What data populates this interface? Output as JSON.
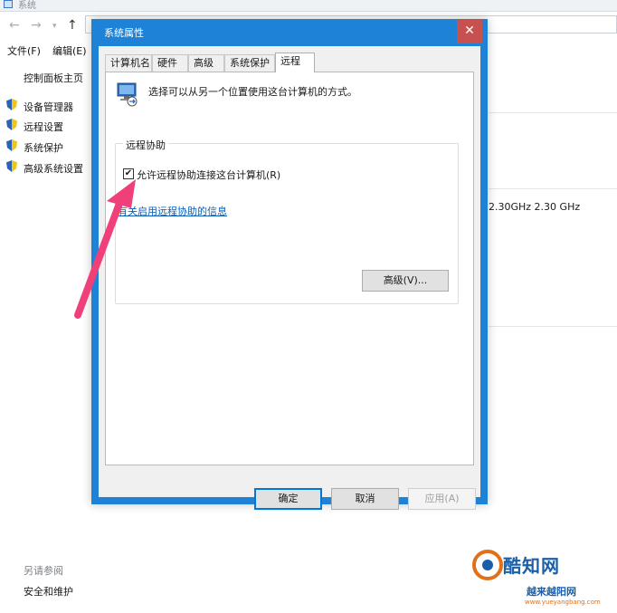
{
  "background_window": {
    "title": "系统",
    "menu": {
      "file": "文件(F)",
      "edit": "编辑(E)"
    },
    "sidebar": {
      "home": "控制面板主页",
      "items": [
        {
          "label": "设备管理器",
          "icon": "shield-icon"
        },
        {
          "label": "远程设置",
          "icon": "shield-icon"
        },
        {
          "label": "系统保护",
          "icon": "shield-icon"
        },
        {
          "label": "高级系统设置",
          "icon": "shield-icon"
        }
      ],
      "see_also": "另请参阅",
      "security_maintenance": "安全和维护"
    },
    "processor_speed": "2.30GHz   2.30 GHz"
  },
  "dialog": {
    "title": "系统属性",
    "close_glyph": "✕",
    "tabs": [
      "计算机名",
      "硬件",
      "高级",
      "系统保护",
      "远程"
    ],
    "active_tab": "远程",
    "description": "选择可以从另一个位置使用这台计算机的方式。",
    "remote_assistance": {
      "legend": "远程协助",
      "allow_label": "允许远程协助连接这台计算机(R)",
      "allow_checked": true,
      "check_glyph": "✔",
      "info_link": "有关启用远程协助的信息",
      "advanced_button": "高级(V)..."
    },
    "buttons": {
      "ok": "确定",
      "cancel": "取消",
      "apply": "应用(A)",
      "apply_enabled": false
    }
  },
  "annotation": {
    "color": "#f0407a"
  },
  "watermark": {
    "brand": "酷知网",
    "sub": "越来越阳网",
    "url": "www.yueyangbang.com"
  },
  "colors": {
    "accent": "#1e83d6",
    "close": "#c75050",
    "link": "#0a5fb4"
  }
}
